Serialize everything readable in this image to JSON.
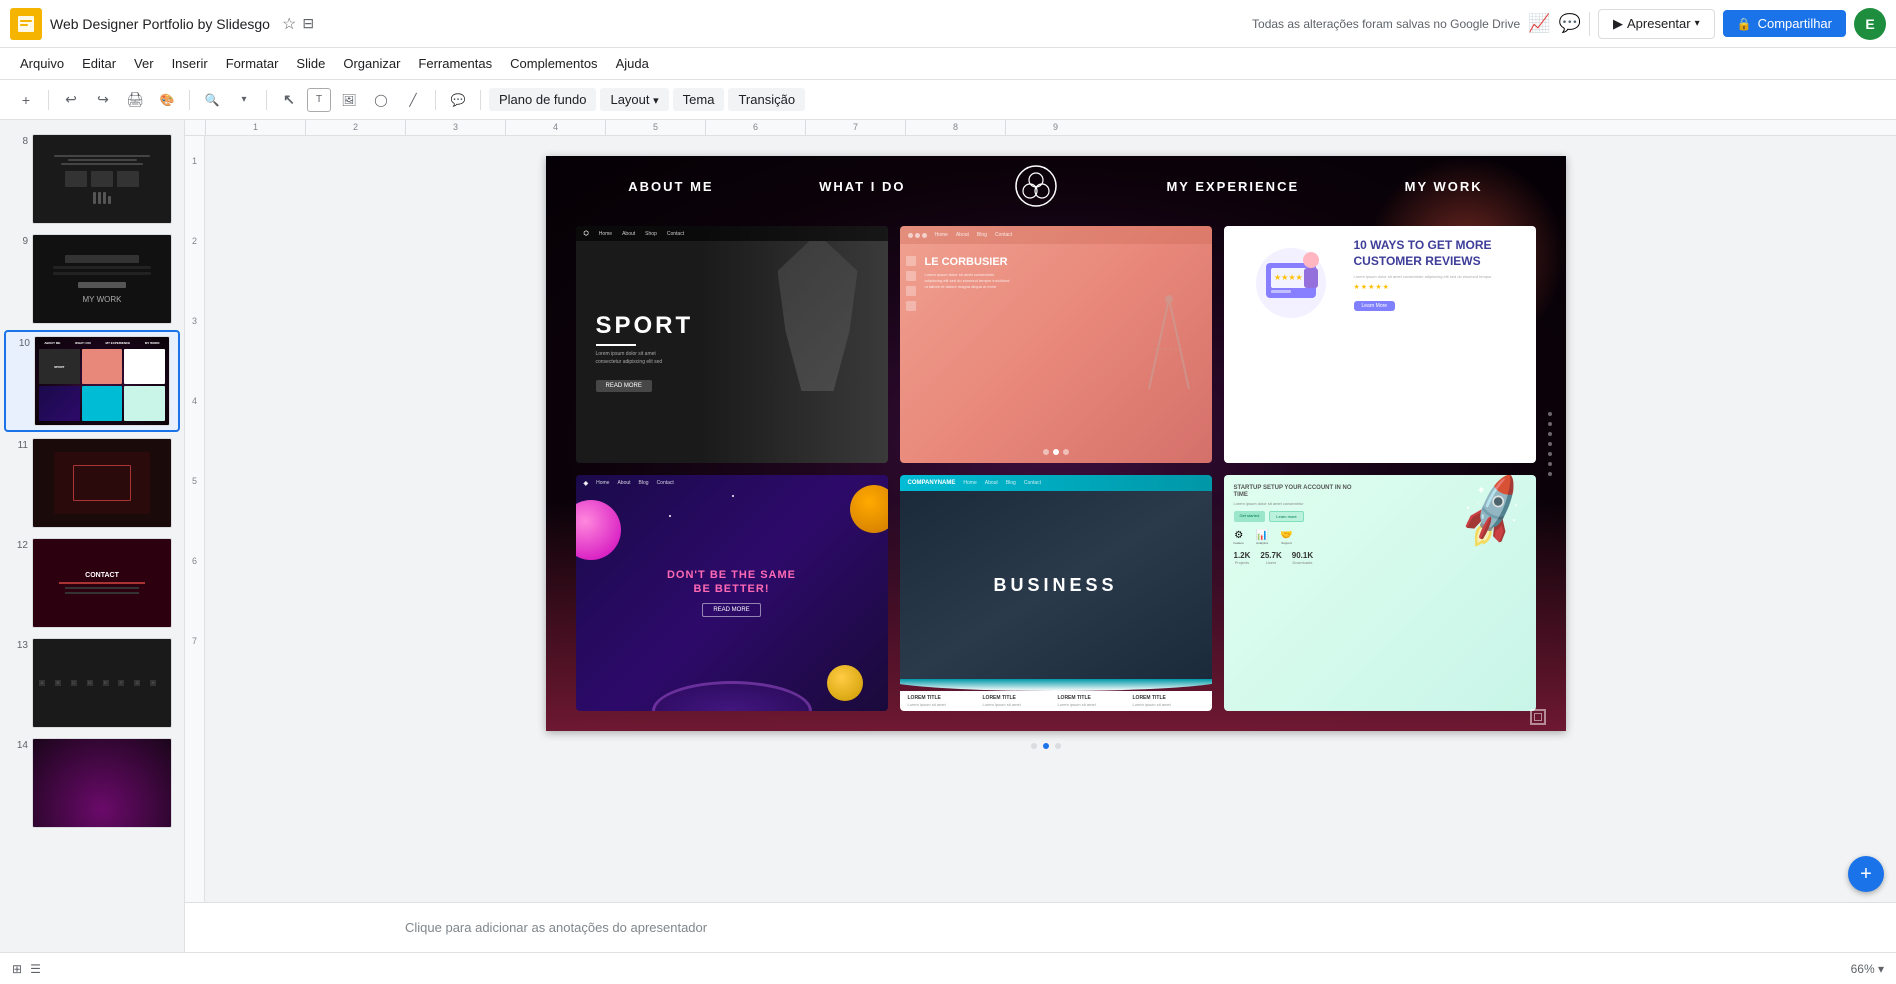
{
  "app": {
    "title": "Web Designer Portfolio by Slidesgo",
    "save_status": "Todas as alterações foram salvas no Google Drive"
  },
  "menu": {
    "items": [
      "Arquivo",
      "Editar",
      "Ver",
      "Inserir",
      "Formatar",
      "Slide",
      "Organizar",
      "Ferramentas",
      "Complementos",
      "Ajuda"
    ]
  },
  "toolbar": {
    "background_label": "Plano de fundo",
    "layout_label": "Layout",
    "theme_label": "Tema",
    "transition_label": "Transição"
  },
  "sidebar": {
    "slides": [
      {
        "num": "8"
      },
      {
        "num": "9"
      },
      {
        "num": "10",
        "active": true
      },
      {
        "num": "11"
      },
      {
        "num": "12"
      },
      {
        "num": "13"
      },
      {
        "num": "14"
      }
    ]
  },
  "slide": {
    "nav": {
      "items": [
        "ABOUT ME",
        "WHAT I DO",
        "MY EXPERIENCE",
        "MY WORK"
      ]
    },
    "screenshots": [
      {
        "id": "sport",
        "nav": [
          "Home",
          "About",
          "Shop",
          "Contact"
        ],
        "title": "SPORT",
        "btn": "READ MORE"
      },
      {
        "id": "lecorbusier",
        "nav": [
          "Home",
          "About",
          "Blog",
          "Contact"
        ],
        "title": "LE CORBUSIER",
        "dots": 3
      },
      {
        "id": "10ways",
        "title": "10 WAYS TO GET MORE CUSTOMER REVIEWS",
        "btn": "Learn More",
        "stars": 5
      },
      {
        "id": "space",
        "nav": [
          "Home",
          "About",
          "Blog",
          "Contact"
        ],
        "title1": "DON'T BE THE SAME",
        "title2": "BE BETTER!",
        "btn": "READ MORE"
      },
      {
        "id": "business",
        "logo": "COMPANYNAME",
        "nav": [
          "Home",
          "About",
          "Blog",
          "Contact"
        ],
        "title": "BUSINESS",
        "cols": [
          "LOREM TITLE",
          "LOREM TITLE",
          "LOREM TITLE",
          "LOREM TITLE"
        ]
      },
      {
        "id": "startup",
        "title": "STARTUP SETUP YOUR ACCOUNT IN NO TIME",
        "btns": [
          "Get started",
          "Learn more"
        ],
        "stats": [
          {
            "num": "1.2K",
            "label": "Projects"
          },
          {
            "num": "25.7K",
            "label": "Users"
          },
          {
            "num": "90.1K",
            "label": "Downloads"
          }
        ]
      }
    ]
  },
  "notes": {
    "placeholder": "Clique para adicionar as anotações do apresentador"
  },
  "buttons": {
    "present": "Apresentar",
    "share": "Compartilhar"
  },
  "avatar": {
    "initial": "E"
  }
}
